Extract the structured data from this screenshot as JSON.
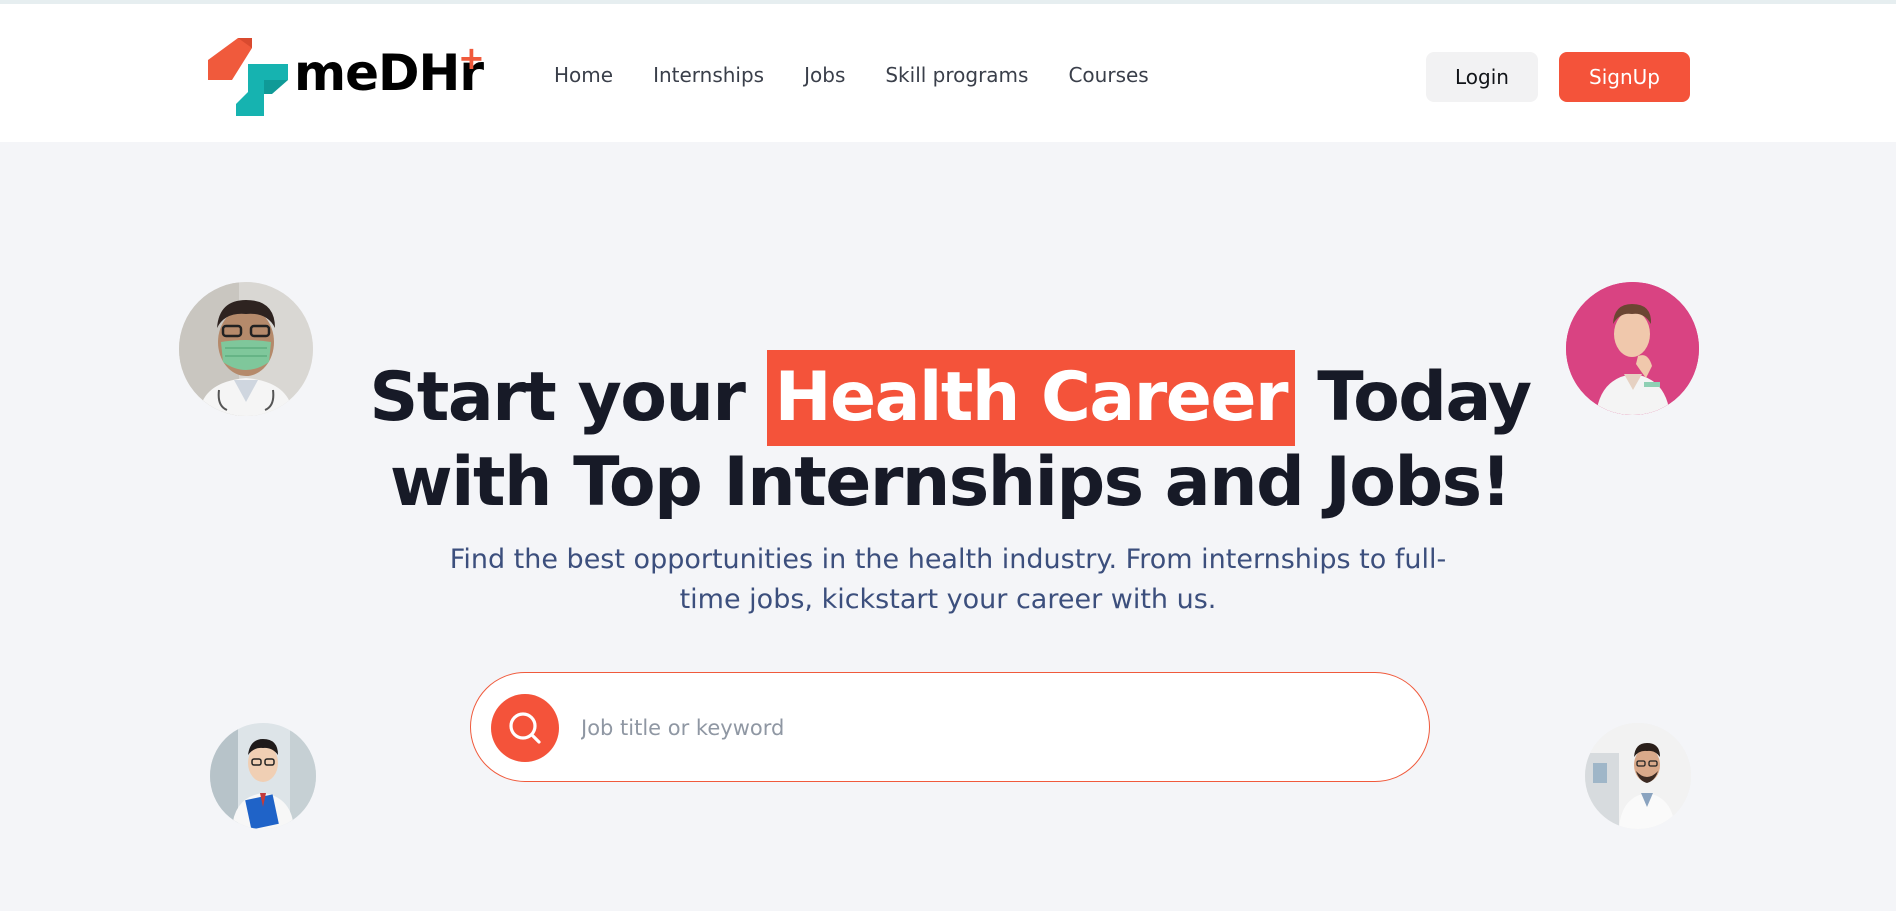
{
  "header": {
    "logo_text": "meDHr",
    "nav": [
      {
        "label": "Home"
      },
      {
        "label": "Internships"
      },
      {
        "label": "Jobs"
      },
      {
        "label": "Skill programs"
      },
      {
        "label": "Courses"
      }
    ],
    "login_label": "Login",
    "signup_label": "SignUp"
  },
  "hero": {
    "headline_start": "Start your ",
    "headline_highlight": "Health Career",
    "headline_end": " Today",
    "headline_line2": "with Top Internships and Jobs!",
    "subtitle": "Find the best opportunities in the health industry. From internships to full-time jobs, kickstart your career with us."
  },
  "search": {
    "placeholder": "Job title or keyword",
    "value": ""
  },
  "colors": {
    "accent": "#f4533a",
    "teal": "#16b3b0",
    "headline": "#171a27",
    "subtitle": "#3c4f7d",
    "background": "#f4f5f8"
  },
  "icons": {
    "search": "search-icon",
    "logo": "medhr-logo-icon"
  }
}
